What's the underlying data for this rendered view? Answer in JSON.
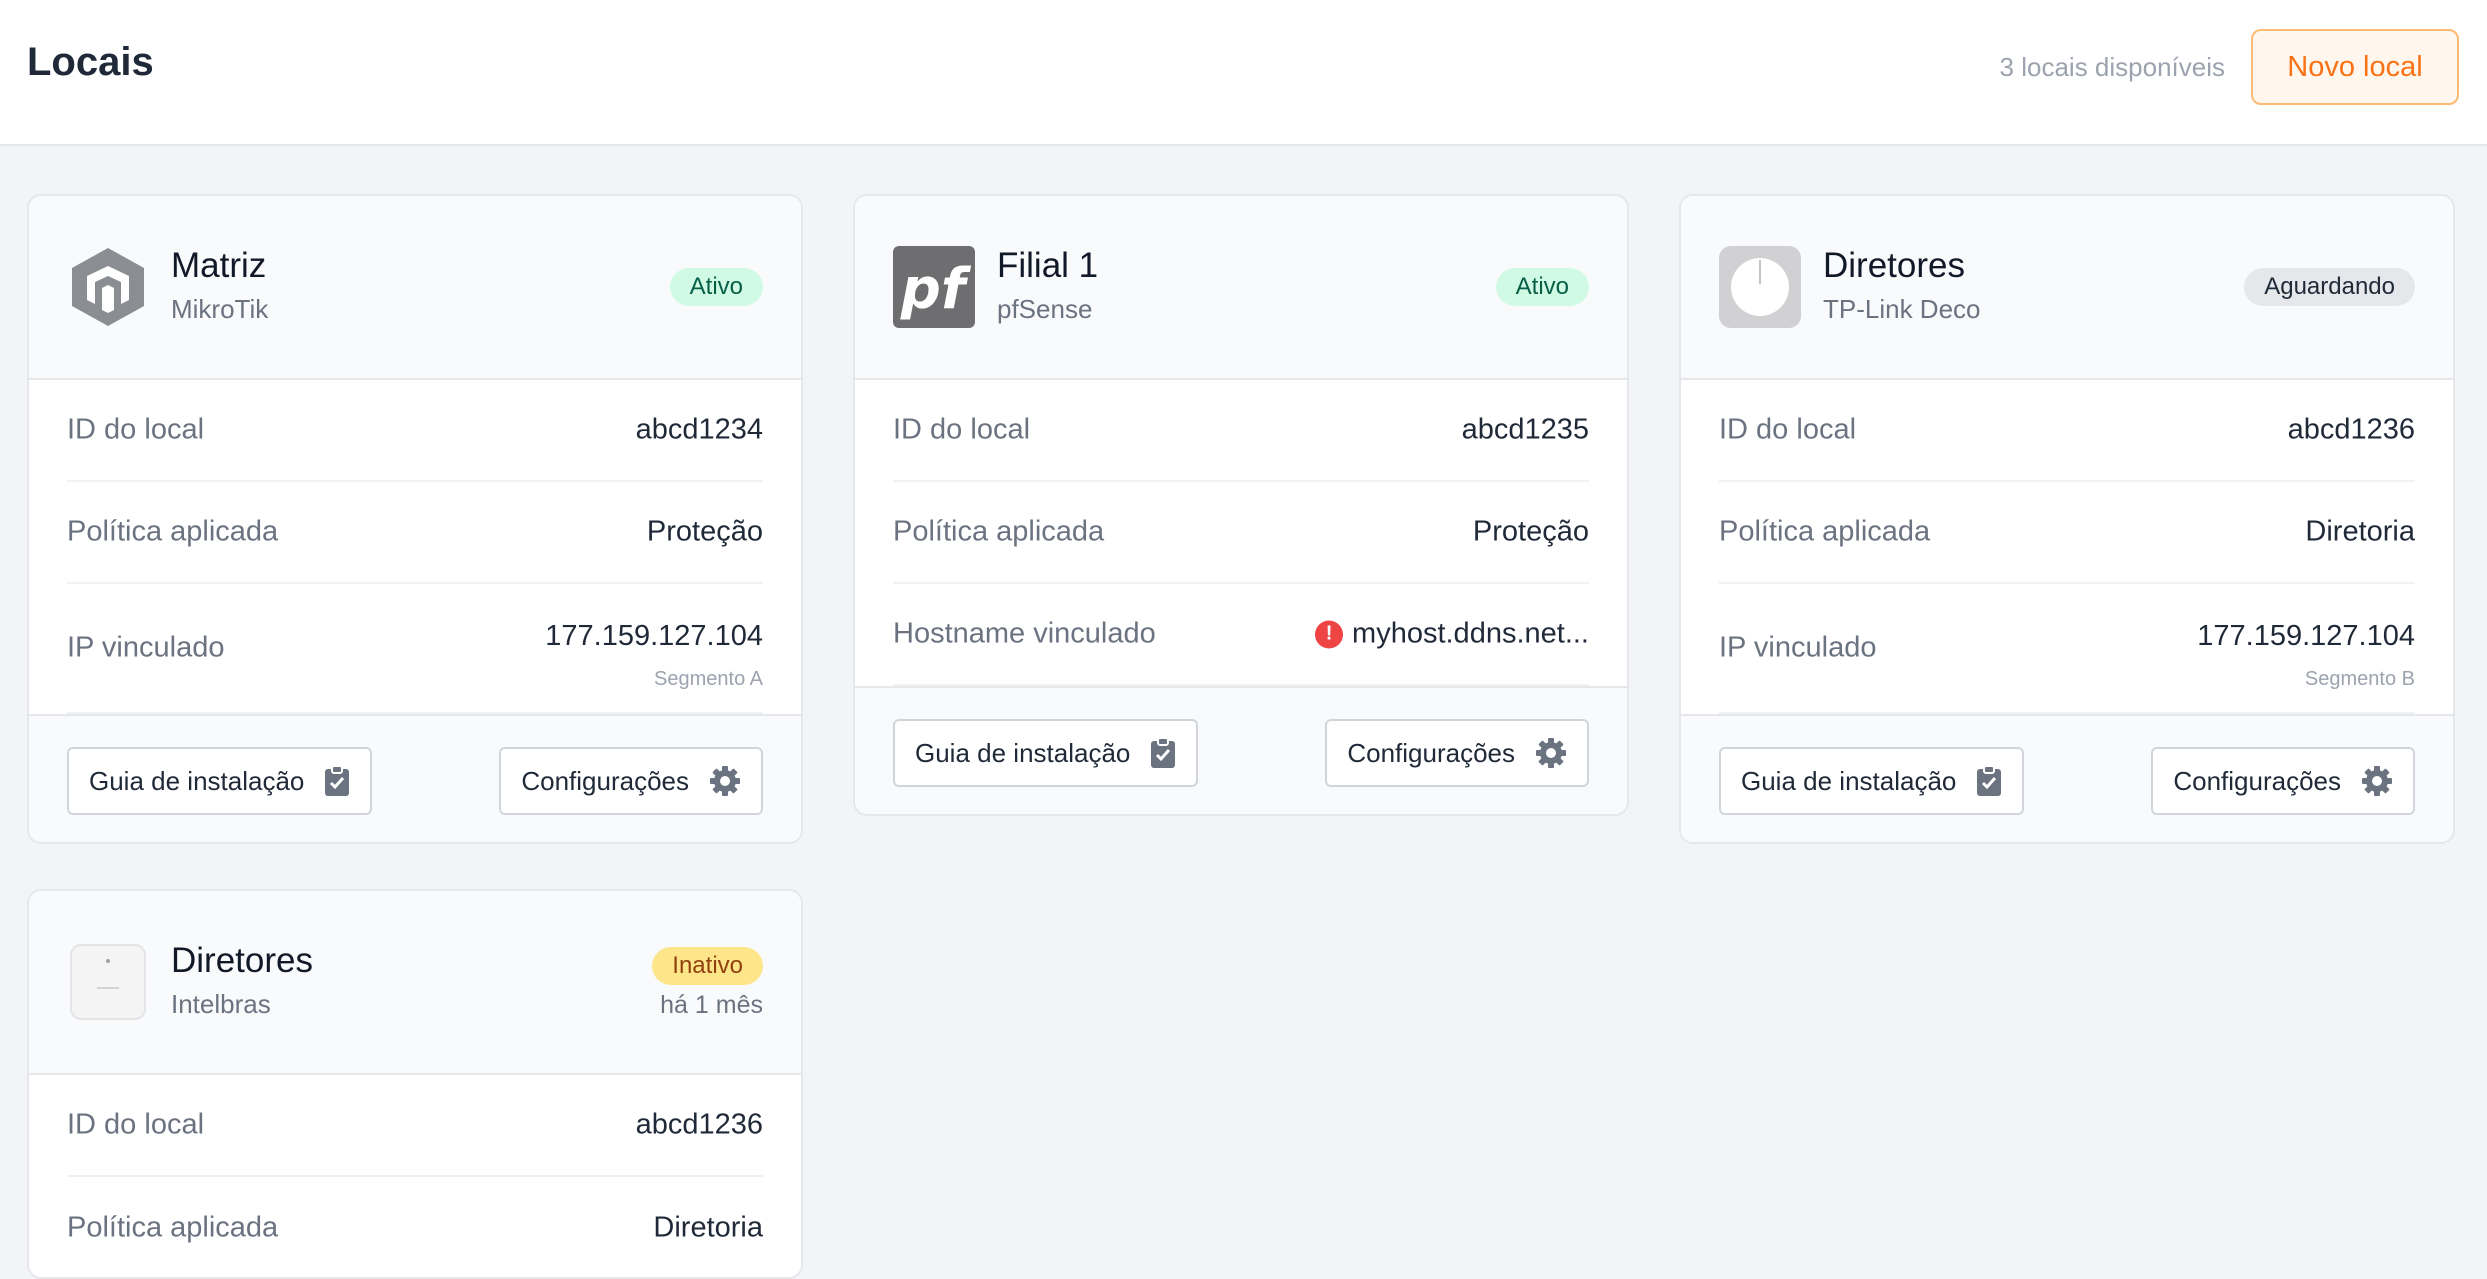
{
  "header": {
    "title": "Locais",
    "available": "3 locais disponíveis",
    "new_button": "Novo local"
  },
  "labels": {
    "site_id": "ID do local",
    "policy": "Política aplicada",
    "ip": "IP vinculado",
    "hostname": "Hostname vinculado",
    "guide_button": "Guia de instalação",
    "config_button": "Configurações"
  },
  "cards": [
    {
      "name": "Matriz",
      "vendor": "MikroTik",
      "status": "Ativo",
      "site_id": "abcd1234",
      "policy": "Proteção",
      "ip": "177.159.127.104",
      "segment": "Segmento A"
    },
    {
      "name": "Filial 1",
      "vendor": "pfSense",
      "status": "Ativo",
      "site_id": "abcd1235",
      "policy": "Proteção",
      "hostname": "myhost.ddns.net..."
    },
    {
      "name": "Diretores",
      "vendor": "TP-Link Deco",
      "status": "Aguardando",
      "site_id": "abcd1236",
      "policy": "Diretoria",
      "ip": "177.159.127.104",
      "segment": "Segmento B"
    },
    {
      "name": "Diretores",
      "vendor": "Intelbras",
      "status": "Inativo",
      "status_sub": "há 1 mês",
      "site_id": "abcd1236",
      "policy": "Diretoria"
    }
  ],
  "icons": {
    "mikrotik": "mikrotik-logo-icon",
    "pfsense": "pfsense-logo-icon",
    "tplink": "tplink-deco-logo-icon",
    "intelbras": "intelbras-device-icon",
    "guide": "clipboard-check-icon",
    "config": "gear-icon",
    "alert": "alert-circle-icon"
  },
  "colors": {
    "accent": "#f97316",
    "active_bg": "#d1fae5",
    "active_text": "#065f46",
    "waiting_bg": "#e5e7eb",
    "inactive_bg": "#fde68a",
    "inactive_text": "#92400e",
    "alert": "#ef4444"
  }
}
